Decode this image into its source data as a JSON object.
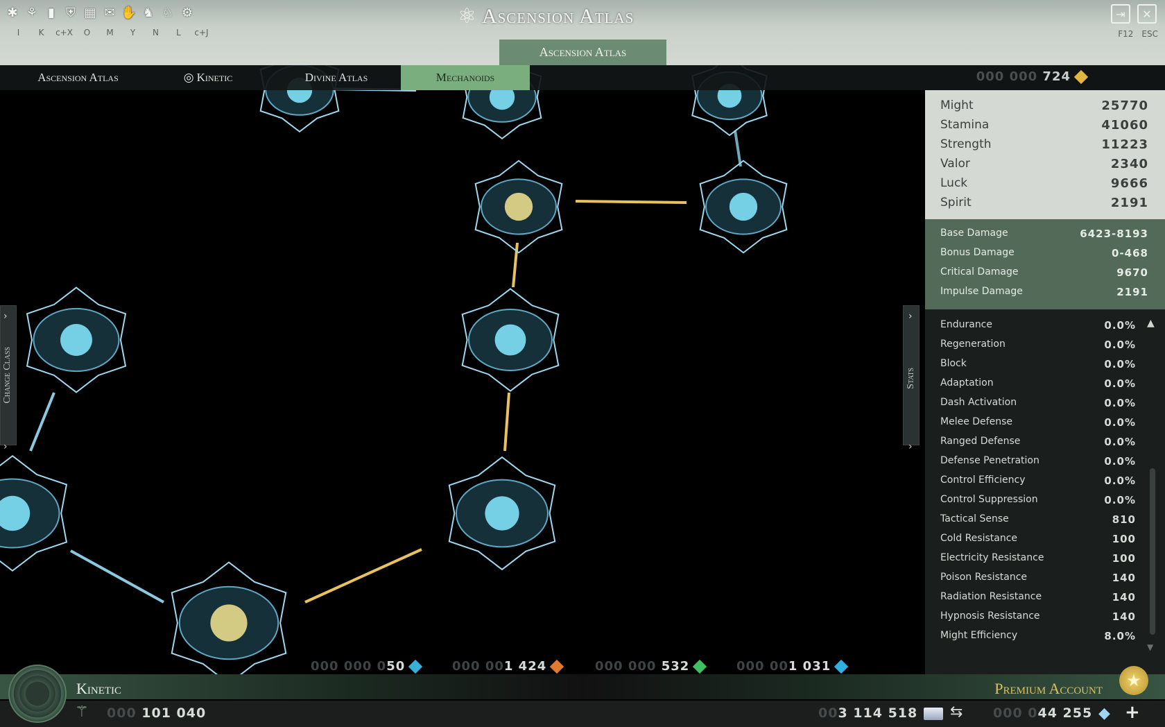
{
  "toolbar": {
    "icons": [
      "squad-icon",
      "graph-icon",
      "stats-chart-icon",
      "shield-icon",
      "map-icon",
      "chat-icon",
      "handshake-icon",
      "fox-icon",
      "horse-icon",
      "gear-icon"
    ],
    "hotkeys": [
      "I",
      "K",
      "c+X",
      "O",
      "M",
      "Y",
      "N",
      "L",
      "c+J"
    ],
    "right_keys": [
      "F12",
      "ESC"
    ]
  },
  "title": "Ascension Atlas",
  "title_tab": "Ascension Atlas",
  "nav": {
    "tabs": [
      "Ascension Atlas",
      "Kinetic",
      "Divine Atlas",
      "Mechanoids"
    ],
    "active_index": 3
  },
  "currency_top": {
    "dim": "000 000 ",
    "value": "724",
    "color": "#e0b540"
  },
  "stats_primary": [
    {
      "label": "Might",
      "value": "25770"
    },
    {
      "label": "Stamina",
      "value": "41060"
    },
    {
      "label": "Strength",
      "value": "11223"
    },
    {
      "label": "Valor",
      "value": "2340"
    },
    {
      "label": "Luck",
      "value": "9666"
    },
    {
      "label": "Spirit",
      "value": "2191"
    }
  ],
  "stats_damage": [
    {
      "label": "Base Damage",
      "value": "6423-8193"
    },
    {
      "label": "Bonus Damage",
      "value": "0-468"
    },
    {
      "label": "Critical Damage",
      "value": "9670"
    },
    {
      "label": "Impulse Damage",
      "value": "2191"
    }
  ],
  "stats_secondary": [
    {
      "label": "Endurance",
      "value": "0.0%"
    },
    {
      "label": "Regeneration",
      "value": "0.0%"
    },
    {
      "label": "Block",
      "value": "0.0%"
    },
    {
      "label": "Adaptation",
      "value": "0.0%"
    },
    {
      "label": "Dash Activation",
      "value": "0.0%"
    },
    {
      "label": "Melee Defense",
      "value": "0.0%"
    },
    {
      "label": "Ranged Defense",
      "value": "0.0%"
    },
    {
      "label": "Defense Penetration",
      "value": "0.0%"
    },
    {
      "label": "Control Efficiency",
      "value": "0.0%"
    },
    {
      "label": "Control Suppression",
      "value": "0.0%"
    },
    {
      "label": "Tactical Sense",
      "value": "810"
    },
    {
      "label": "Cold Resistance",
      "value": "100"
    },
    {
      "label": "Electricity Resistance",
      "value": "100"
    },
    {
      "label": "Poison Resistance",
      "value": "140"
    },
    {
      "label": "Radiation Resistance",
      "value": "140"
    },
    {
      "label": "Hypnosis Resistance",
      "value": "140"
    },
    {
      "label": "Might Efficiency",
      "value": "8.0%"
    }
  ],
  "side_tabs": {
    "left": "Change Class",
    "right": "Stats"
  },
  "resources": [
    {
      "dim": "000 000 0",
      "value": "50",
      "color": "#3ab0d8"
    },
    {
      "dim": "000 00",
      "value": "1 424",
      "color": "#e07a30"
    },
    {
      "dim": "000 000 ",
      "value": "532",
      "color": "#40c060"
    },
    {
      "dim": "000 00",
      "value": "1 031",
      "color": "#30b0e0"
    }
  ],
  "class_name": "Kinetic",
  "premium": "Premium Account",
  "bottom": {
    "exp": {
      "dim": "000 ",
      "value": "101 040"
    },
    "credits": {
      "dim": "00",
      "value": "3 114 518"
    },
    "gems": {
      "dim": "000 0",
      "value": "44 255"
    }
  }
}
